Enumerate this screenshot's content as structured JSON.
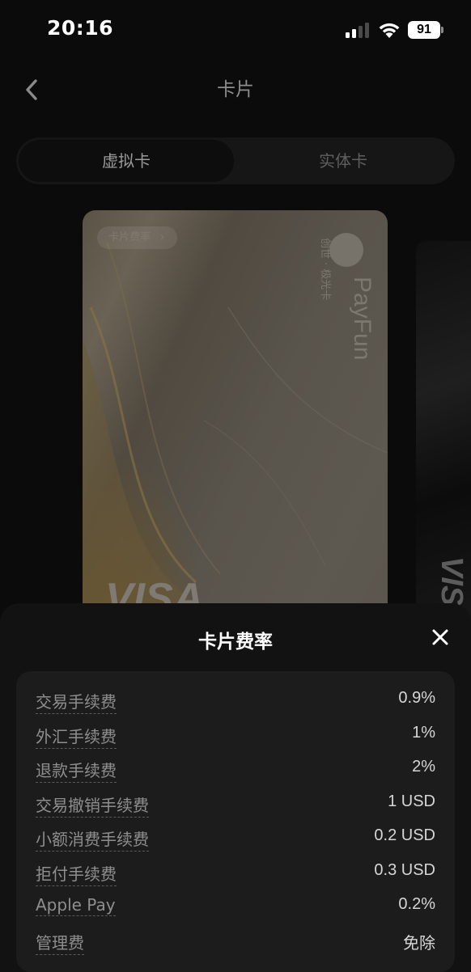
{
  "status_bar": {
    "time": "20:16",
    "battery": "91"
  },
  "nav": {
    "title": "卡片"
  },
  "tabs": [
    {
      "label": "虚拟卡",
      "selected": true
    },
    {
      "label": "实体卡",
      "selected": false
    }
  ],
  "card": {
    "fee_link": "卡片费率",
    "brand_name": "PayFun",
    "card_type": "创世 · 极光卡",
    "network": "VISA"
  },
  "sheet": {
    "title": "卡片费率",
    "fees": [
      {
        "name": "交易手续费",
        "value": "0.9%"
      },
      {
        "name": "外汇手续费",
        "value": "1%"
      },
      {
        "name": "退款手续费",
        "value": "2%"
      },
      {
        "name": "交易撤销手续费",
        "value": "1 USD"
      },
      {
        "name": "小额消费手续费",
        "value": "0.2 USD"
      },
      {
        "name": "拒付手续费",
        "value": "0.3 USD"
      },
      {
        "name": "Apple Pay",
        "value": "0.2%"
      },
      {
        "name": "管理费",
        "value": "免除"
      }
    ]
  },
  "colors": {
    "background": "#0b0b0b",
    "sheet": "#121212",
    "panel": "#1c1c1c",
    "text_primary": "#ffffff",
    "text_secondary": "#8e8e8e"
  }
}
